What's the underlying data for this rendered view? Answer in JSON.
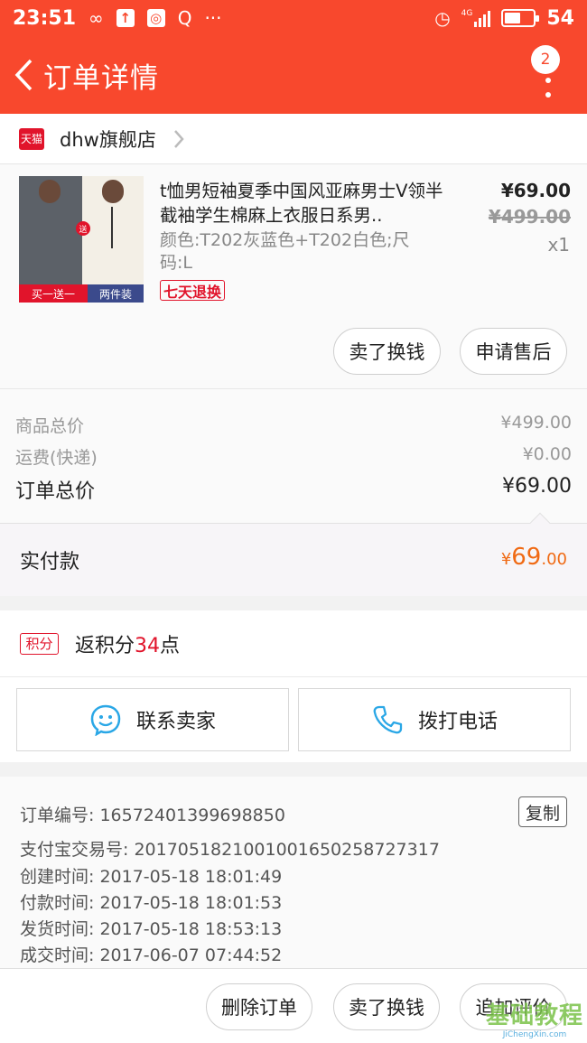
{
  "status_bar": {
    "time": "23:51",
    "icons": [
      "infinity-icon",
      "upload-icon",
      "wifi-hotspot-icon",
      "search-q-icon",
      "more-dots-icon",
      "alarm-icon",
      "signal-icon",
      "battery-icon"
    ],
    "network": "4G",
    "battery": "54",
    "battery_level": 0.54
  },
  "navbar": {
    "title": "订单详情",
    "badge": "2"
  },
  "store": {
    "badge": "天猫",
    "name": "dhw旗舰店"
  },
  "item": {
    "title": "t恤男短袖夏季中国风亚麻男士V领半截袖学生棉麻上衣服日系男..",
    "spec": "颜色:T202灰蓝色+T202白色;尺码:L",
    "tag": "七天退换",
    "price": "¥69.00",
    "original_price": "¥499.00",
    "quantity": "x1",
    "thumb_left_label": "买一送一",
    "thumb_right_label": "两件装",
    "thumb_gift": "送",
    "buttons": {
      "sell": "卖了换钱",
      "after_sale": "申请售后"
    }
  },
  "summary": {
    "goods_total_label": "商品总价",
    "goods_total": "¥499.00",
    "shipping_label": "运费(快递)",
    "shipping": "¥0.00",
    "order_total_label": "订单总价",
    "order_total": "¥69.00"
  },
  "paid": {
    "label": "实付款",
    "currency": "¥",
    "integer": "69",
    "decimal": ".00"
  },
  "points": {
    "badge": "积分",
    "prefix": "返积分",
    "value": "34",
    "suffix": "点"
  },
  "contact": {
    "seller": "联系卖家",
    "call": "拨打电话"
  },
  "order_info": {
    "order_no": "订单编号: 16572401399698850",
    "copy": "复制",
    "alipay_no": "支付宝交易号: 2017051821001001650258727317",
    "created": "创建时间: 2017-05-18 18:01:49",
    "paid": "付款时间: 2017-05-18 18:01:53",
    "shipped": "发货时间: 2017-05-18 18:53:13",
    "completed": "成交时间: 2017-06-07 07:44:52"
  },
  "bottom": {
    "delete": "删除订单",
    "sell": "卖了换钱",
    "review": "追加评价"
  },
  "watermark": {
    "main": "基础教程",
    "sub": "JiChengXin.com"
  },
  "colors": {
    "brand": "#f8482d",
    "tmall_red": "#e1142b",
    "paid_orange": "#f06a14"
  }
}
